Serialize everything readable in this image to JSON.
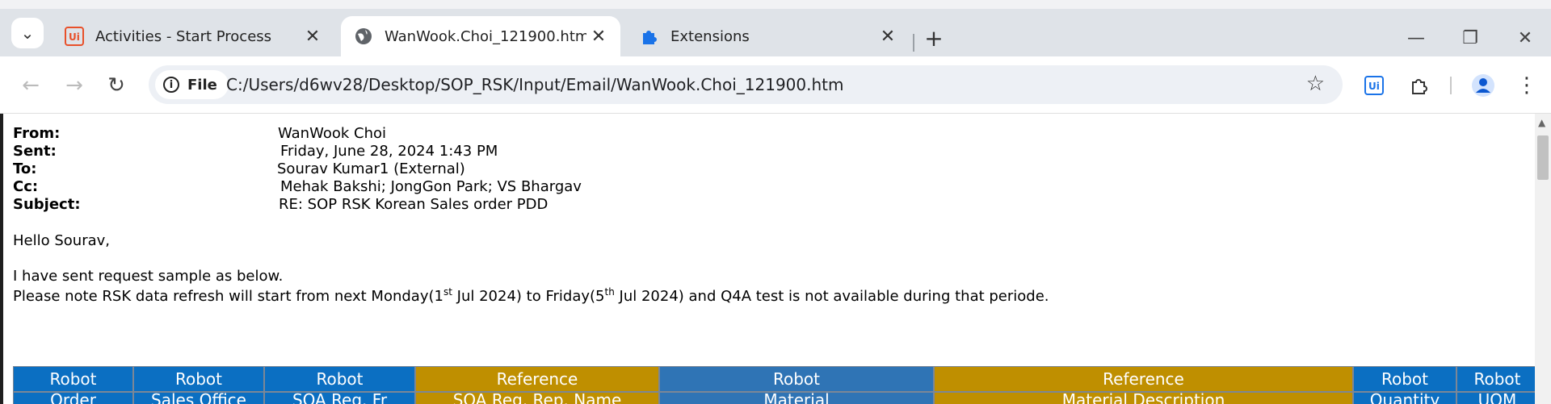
{
  "tabs": [
    {
      "label": "Activities - Start Process",
      "favicon": "uipath-icon"
    },
    {
      "label": "WanWook.Choi_121900.htm",
      "favicon": "globe-icon"
    },
    {
      "label": "Extensions",
      "favicon": "puzzle-icon"
    }
  ],
  "toolbar": {
    "file_chip": "File",
    "url": "C:/Users/d6wv28/Desktop/SOP_RSK/Input/Email/WanWook.Choi_121900.htm"
  },
  "email": {
    "headers": [
      {
        "key": "From:",
        "value": "WanWook Choi"
      },
      {
        "key": "Sent:",
        "value": "Friday, June 28, 2024 1:43 PM"
      },
      {
        "key": "To:",
        "value": "Sourav Kumar1 (External)"
      },
      {
        "key": "Cc:",
        "value": "Mehak Bakshi; JongGon Park; VS Bhargav"
      },
      {
        "key": "Subject:",
        "value": "RE: SOP RSK Korean Sales order PDD"
      }
    ],
    "greeting": "Hello Sourav,",
    "line1": "I have sent request sample as below.",
    "line2": {
      "a": "Please note RSK data refresh will start from next Monday(1",
      "sup1": "st",
      "b": " Jul 2024) to Friday(5",
      "sup2": "th",
      "c": " Jul 2024) and Q4A test is not available during that periode."
    }
  },
  "table": {
    "headers": [
      "Robot",
      "Robot",
      "Robot",
      "Reference",
      "Robot",
      "Reference",
      "Robot",
      "Robot"
    ],
    "subheaders": [
      "Order",
      "Sales Office",
      "SOA Reg. Fr",
      "SOA Reg. Rep. Name",
      "Material",
      "Material Description",
      "Quantity",
      "UOM"
    ],
    "colors": {
      "robot": "#0b6fc2",
      "robot_alt": "#2f74b5",
      "reference": "#bf8f00"
    }
  }
}
